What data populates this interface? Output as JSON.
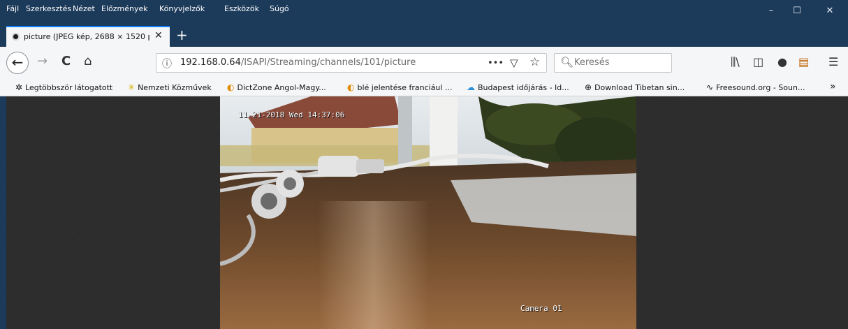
{
  "menubar": {
    "items": [
      "Fájl",
      "Szerkesztés",
      "Nézet",
      "Előzmények",
      "Könyvjelzők",
      "Eszközök",
      "Súgó"
    ]
  },
  "window_controls": {
    "minimize": "–",
    "maximize": "☐",
    "close": "✕"
  },
  "tab": {
    "title": "picture (JPEG kép, 2688 × 1520 p",
    "close": "✕"
  },
  "new_tab": "+",
  "nav": {
    "back": "←",
    "forward": "→",
    "reload": "C",
    "home": "⌂"
  },
  "urlbar": {
    "info_icon": "ⓘ",
    "host": "192.168.0.64",
    "path": "/ISAPI/Streaming/channels/101/picture",
    "more": "•••",
    "pocket": "▽",
    "star": "☆"
  },
  "search": {
    "placeholder": "Keresés"
  },
  "toolbar": {
    "library": "⫼\\",
    "sidebar": "◫",
    "extension": "●",
    "menu": "☰"
  },
  "bookmarks": [
    {
      "label": "Legtöbbször látogatott",
      "icon": "gear-icon"
    },
    {
      "label": "Nemzeti Közművek",
      "icon": "asterisk-icon"
    },
    {
      "label": "DictZone Angol-Magy...",
      "icon": "dictzone-icon"
    },
    {
      "label": "blé jelentése franciául ...",
      "icon": "dictzone-icon"
    },
    {
      "label": "Budapest időjárás - Id...",
      "icon": "cloud-icon"
    },
    {
      "label": "Download Tibetan sin...",
      "icon": "globe-icon"
    },
    {
      "label": "Freesound.org - Soun...",
      "icon": "waveform-icon"
    }
  ],
  "bookmarks_more": "»",
  "camera": {
    "timestamp": "11-21-2018 Wed 14:37:06",
    "label": "Camera 01"
  },
  "colors": {
    "titlebar": "#1c3a5a",
    "toolbar": "#f5f6f7",
    "content_bg": "#2b2b2b",
    "tab_accent": "#0a84ff"
  }
}
